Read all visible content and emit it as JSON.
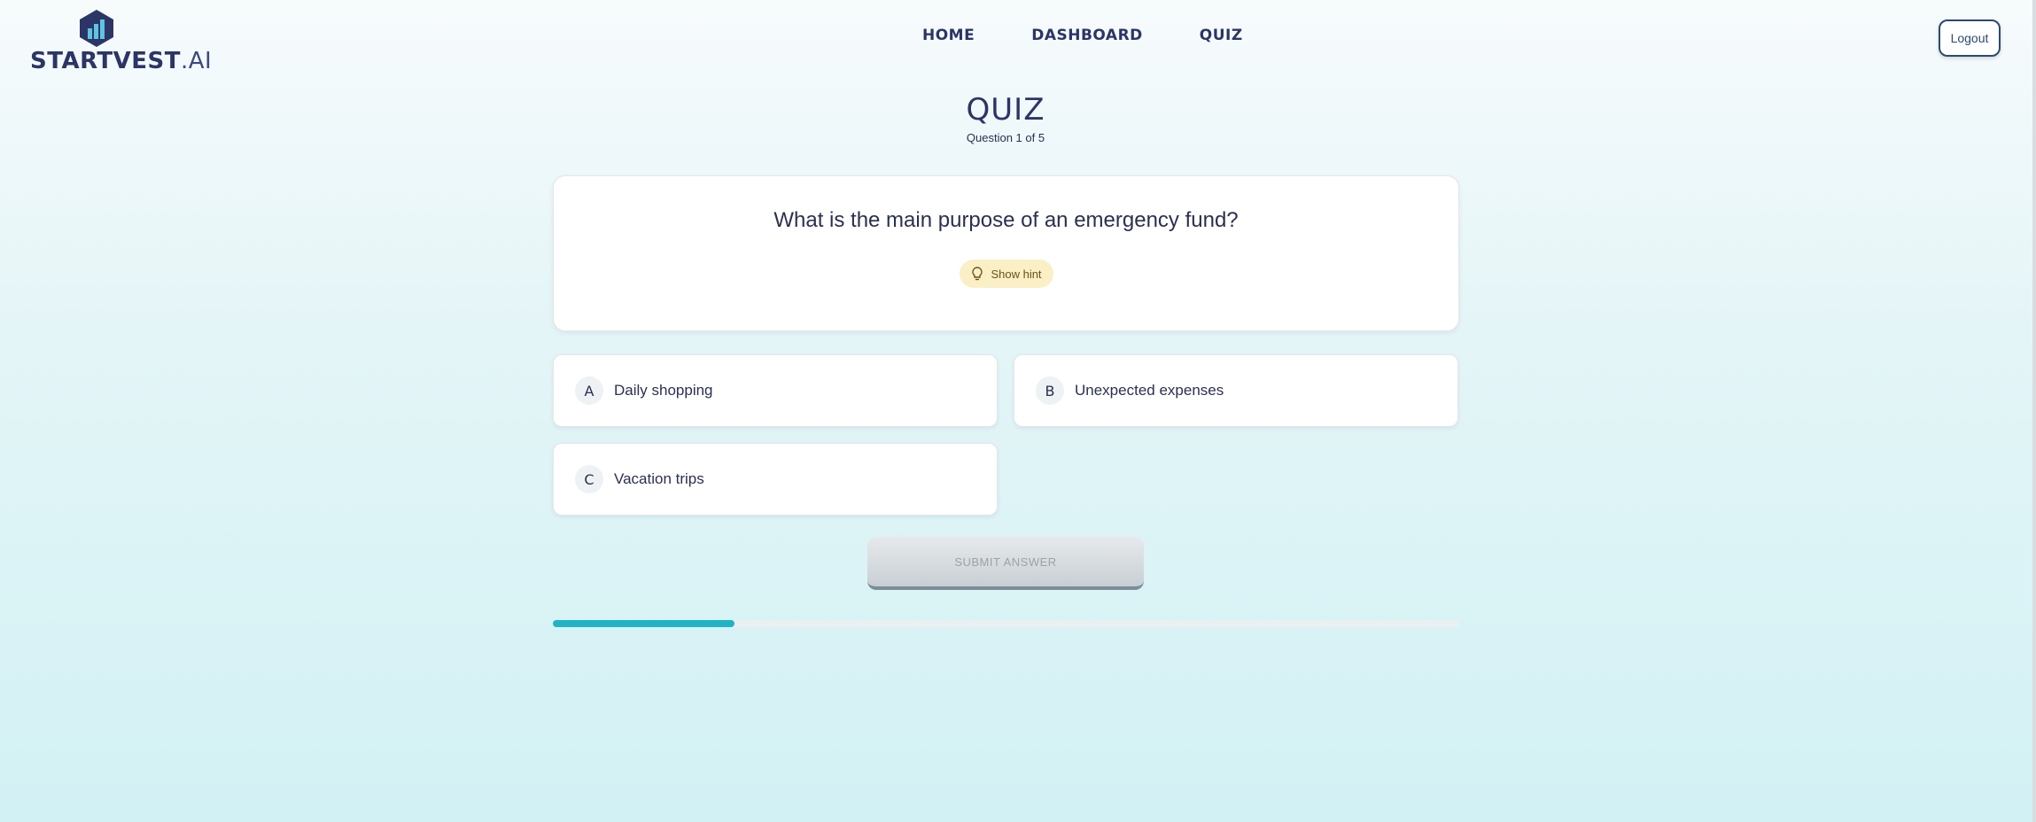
{
  "brand": {
    "name": "STARTVEST",
    "suffix": ".AI"
  },
  "nav": {
    "items": [
      "HOME",
      "DASHBOARD",
      "QUIZ"
    ]
  },
  "header": {
    "logout_label": "Logout"
  },
  "quiz": {
    "title": "QUIZ",
    "subtitle": "Question 1 of 5",
    "question": "What is the main purpose of an emergency fund?",
    "hint_label": "Show hint",
    "options": [
      {
        "letter": "A",
        "label": "Daily shopping"
      },
      {
        "letter": "B",
        "label": "Unexpected expenses"
      },
      {
        "letter": "C",
        "label": "Vacation trips"
      }
    ],
    "submit_label": "SUBMIT ANSWER",
    "progress_percent": 20
  },
  "colors": {
    "accent": "#20b4c4",
    "brand_dark": "#2b3566",
    "hint_bg": "#fbefc6"
  },
  "icons": {
    "hint": "lightbulb-icon",
    "logo": "chart-hexagon-icon"
  }
}
